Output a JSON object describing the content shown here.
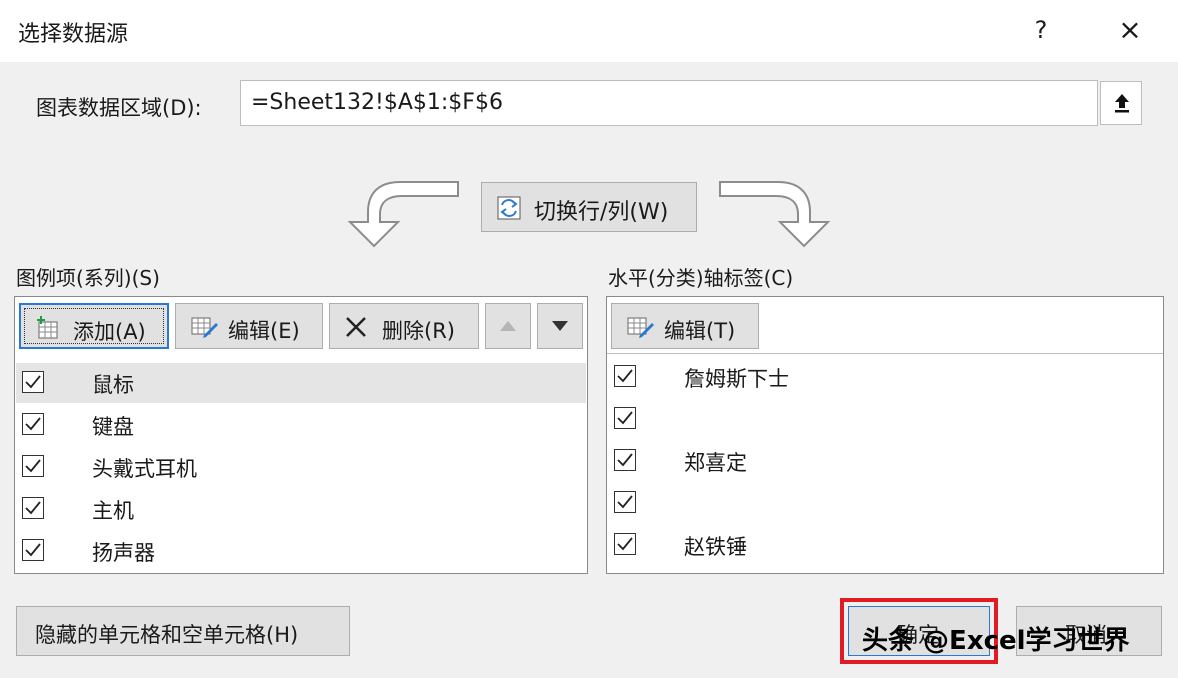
{
  "dialog": {
    "title": "选择数据源",
    "help": "?",
    "close": "×"
  },
  "range": {
    "label": "图表数据区域(D):",
    "value": "=Sheet132!$A$1:$F$6"
  },
  "switch_button": "切换行/列(W)",
  "legend": {
    "label": "图例项(系列)(S)",
    "add": "添加(A)",
    "edit": "编辑(E)",
    "delete": "删除(R)",
    "items": [
      "鼠标",
      "键盘",
      "头戴式耳机",
      "主机",
      "扬声器"
    ],
    "checked": [
      true,
      true,
      true,
      true,
      true
    ]
  },
  "axis": {
    "label": "水平(分类)轴标签(C)",
    "edit": "编辑(T)",
    "items": [
      "詹姆斯下士",
      "",
      "郑喜定",
      "",
      "赵铁锤"
    ],
    "checked": [
      true,
      true,
      true,
      true,
      true
    ]
  },
  "bottom": {
    "hidden_cells": "隐藏的单元格和空单元格(H)",
    "ok": "确定",
    "cancel": "取消"
  },
  "watermark": "头条 @Excel学习世界",
  "colors": {
    "highlight": "#e01b24",
    "focus": "#2a78d4"
  }
}
